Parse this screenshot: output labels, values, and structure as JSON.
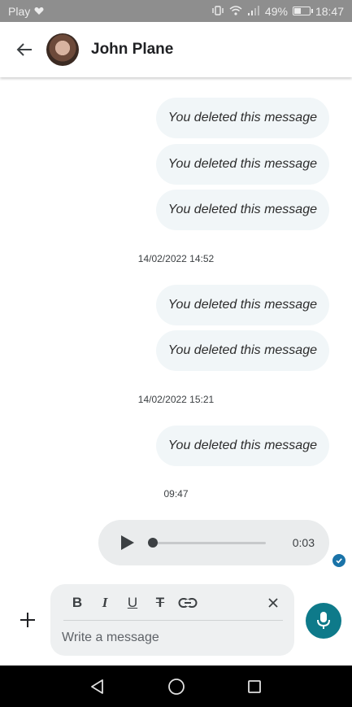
{
  "status_bar": {
    "carrier": "Play",
    "battery_percent": "49%",
    "battery_level": 0.49,
    "time": "18:47",
    "icons": [
      "heart-icon",
      "vibrate-icon",
      "wifi-icon",
      "signal-icon",
      "battery-icon"
    ]
  },
  "header": {
    "contact_name": "John Plane",
    "icons": [
      "back-arrow-icon",
      "avatar"
    ]
  },
  "messages": [
    {
      "type": "deleted",
      "text": "You deleted this message"
    },
    {
      "type": "deleted",
      "text": "You deleted this message"
    },
    {
      "type": "deleted",
      "text": "You deleted this message"
    },
    {
      "type": "timestamp",
      "text": "14/02/2022 14:52"
    },
    {
      "type": "deleted",
      "text": "You deleted this message"
    },
    {
      "type": "deleted",
      "text": "You deleted this message"
    },
    {
      "type": "timestamp",
      "text": "14/02/2022 15:21"
    },
    {
      "type": "deleted",
      "text": "You deleted this message"
    },
    {
      "type": "timestamp",
      "text": "09:47"
    }
  ],
  "audio_message": {
    "duration": "0:03",
    "progress": 0,
    "status": "read-check-icon"
  },
  "composer": {
    "format_buttons": {
      "bold": "B",
      "italic": "I",
      "underline": "U",
      "strikethrough": "T"
    },
    "placeholder": "Write a message",
    "value": "",
    "icons": [
      "plus-icon",
      "link-icon",
      "close-icon",
      "mic-icon"
    ]
  },
  "colors": {
    "status_bar_bg": "#8e8e8e",
    "bubble_bg": "#f1f6f8",
    "audio_bg": "#eaeced",
    "composer_bg": "#eef0f1",
    "mic_button": "#0e7a8a",
    "read_check": "#1a73a8",
    "nav_bar": "#000000"
  },
  "nav_bar": {
    "icons": [
      "nav-back-icon",
      "nav-home-icon",
      "nav-recents-icon"
    ]
  }
}
